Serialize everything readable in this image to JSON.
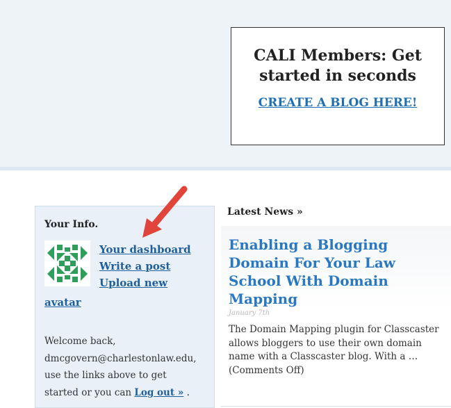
{
  "promo": {
    "heading": "CALI Members: Get started in seconds",
    "cta_link": "CREATE A BLOG HERE!"
  },
  "info_panel": {
    "title": "Your Info.",
    "links": {
      "dashboard": "Your dashboard",
      "write_post": "Write a post",
      "upload_line1": "Upload new",
      "upload_line2": "avatar"
    },
    "welcome_line1": "Welcome back,",
    "email": "dmcgovern@charlestonlaw.edu,",
    "welcome_line2": "use the links above to get",
    "welcome_line3_prefix": "started or you can",
    "logout_label": "Log out »",
    "welcome_line3_suffix": "."
  },
  "news": {
    "section_label": "Latest News »",
    "article": {
      "title": "Enabling a Blogging Domain For Your Law School With Domain Mapping",
      "date": "January 7th",
      "excerpt": "The Domain Mapping plugin for Classcaster allows bloggers to use their own domain name with a Classcaster blog. With a …(Comments Off)"
    }
  },
  "colors": {
    "link": "#1f5f9a",
    "accent_link": "#2a78c2",
    "arrow": "#e0443a",
    "avatar_green": "#2e9e5a"
  },
  "icons": {
    "avatar": "identicon-avatar",
    "pointer": "red-arrow-icon"
  }
}
